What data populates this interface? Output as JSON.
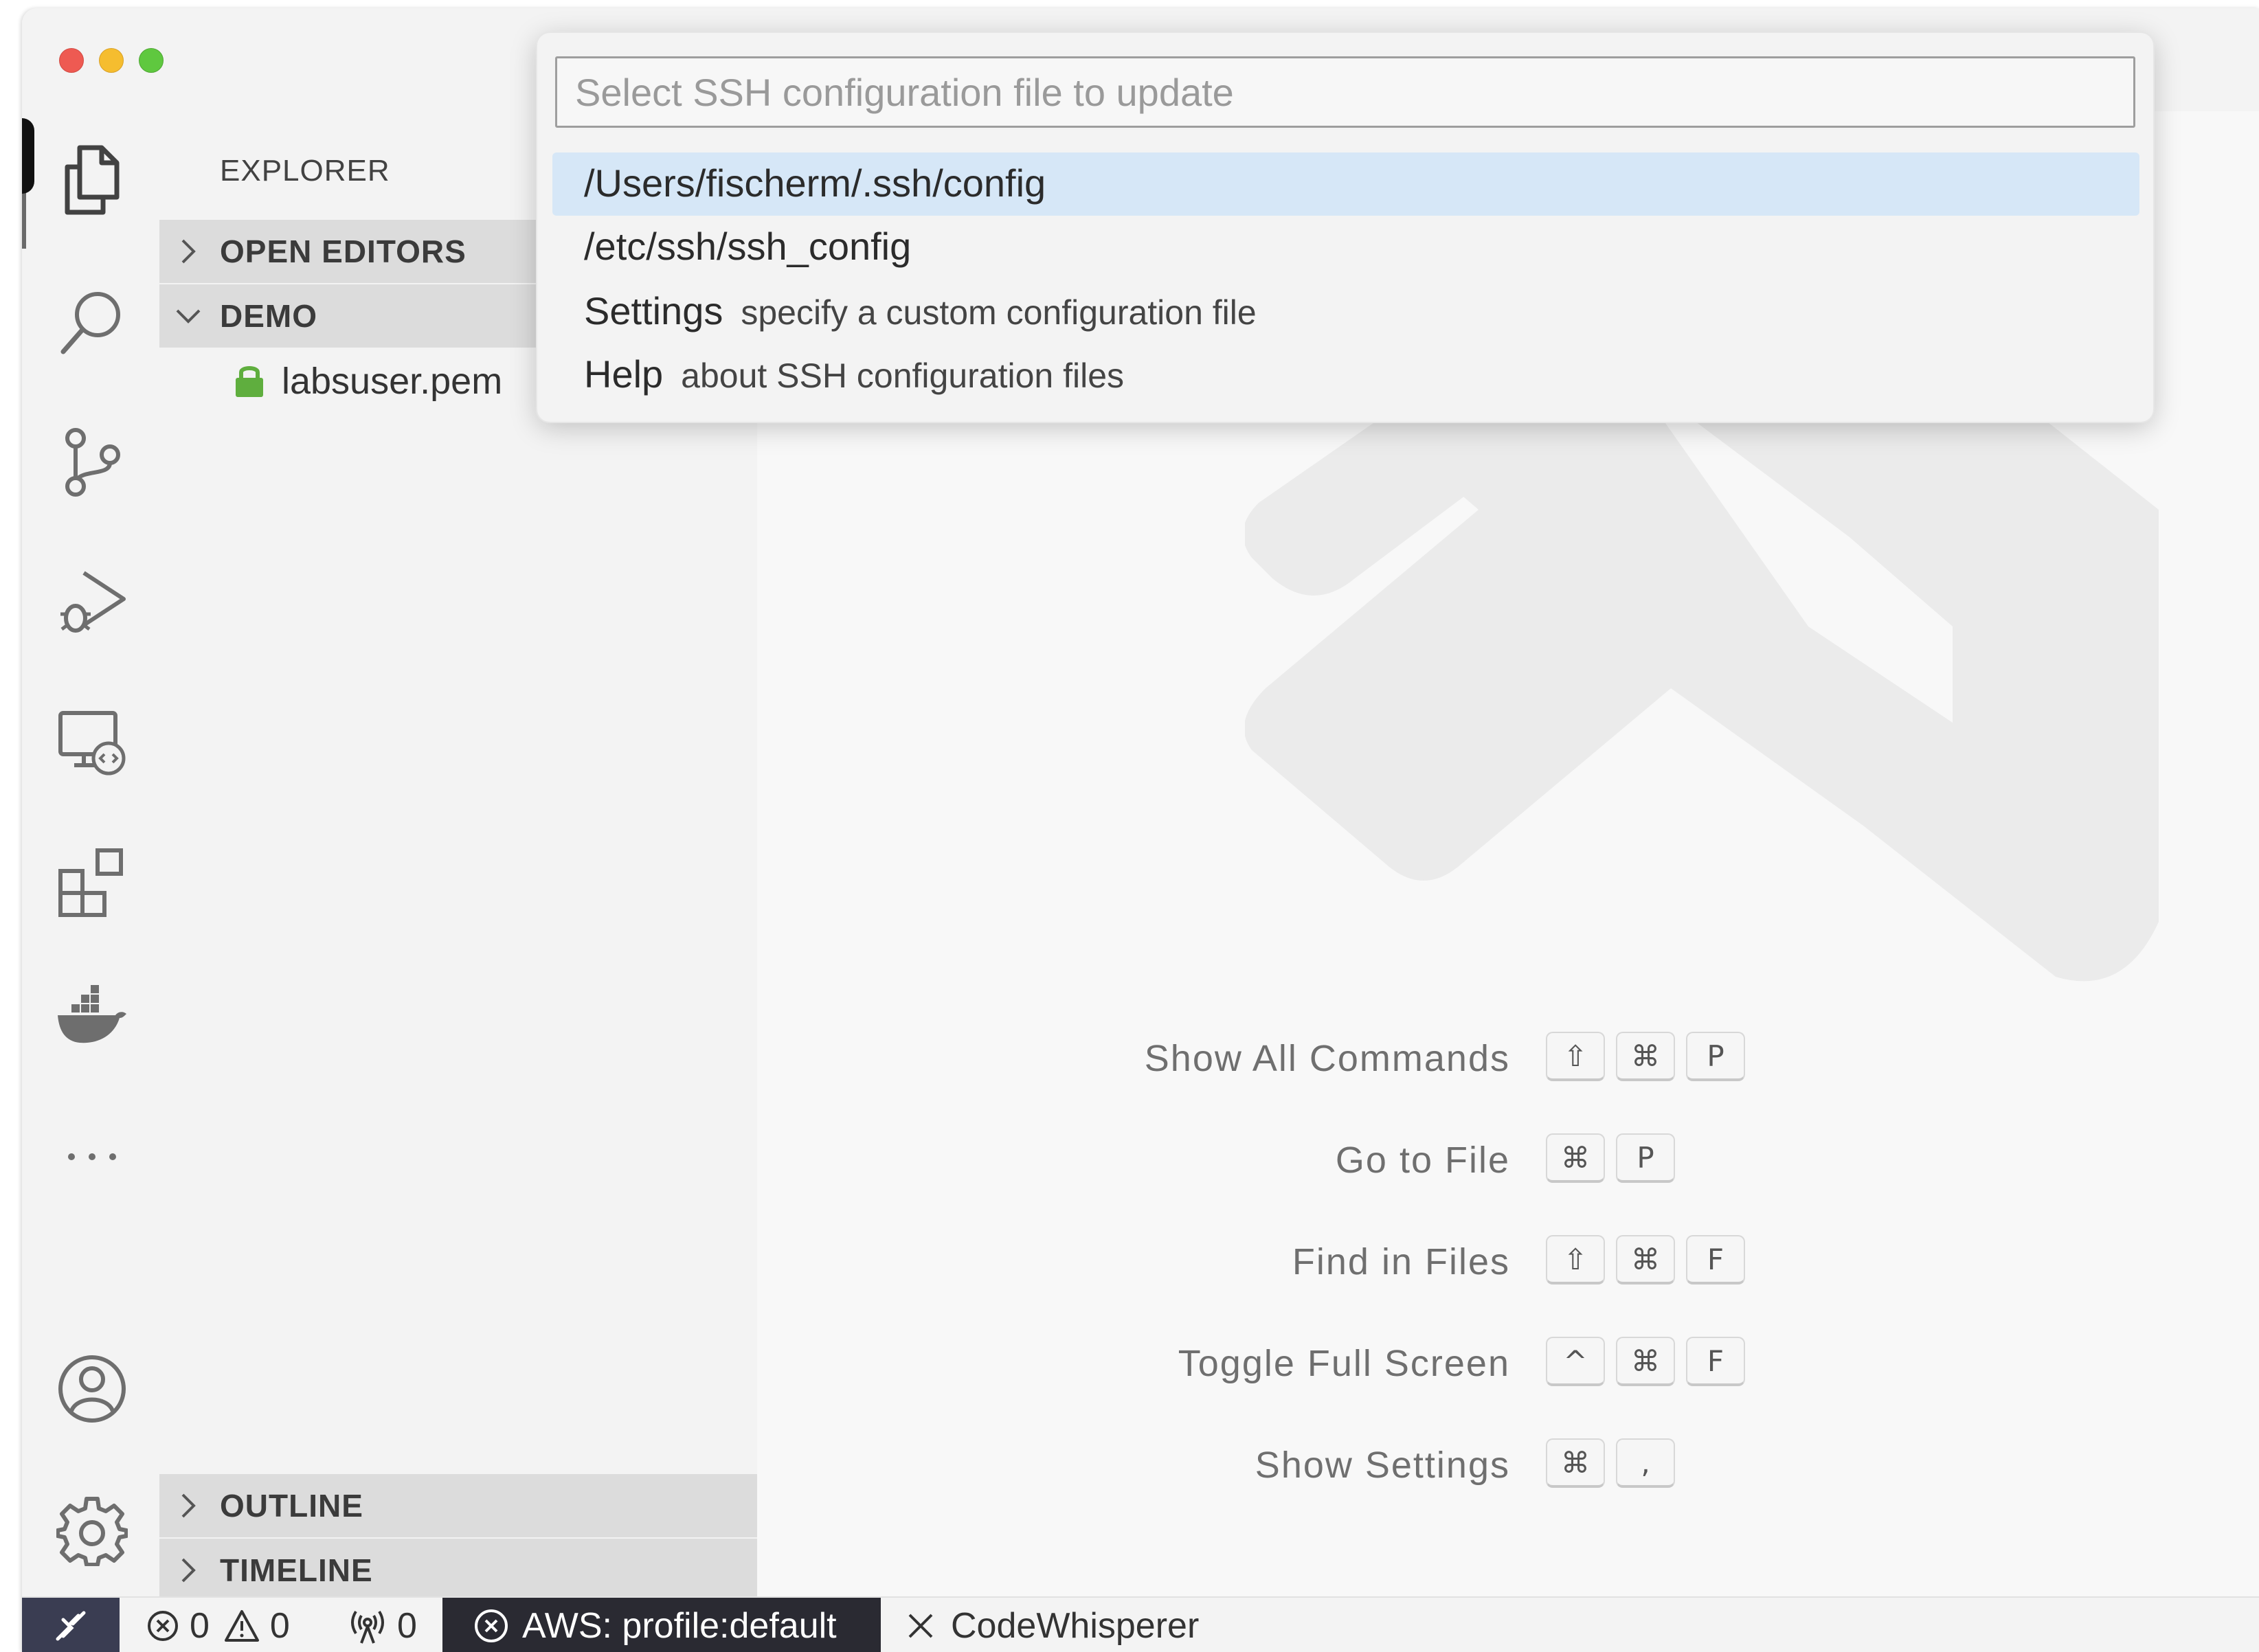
{
  "explorer": {
    "title": "EXPLORER",
    "sections": {
      "open_editors": "OPEN EDITORS",
      "folder": "DEMO",
      "outline": "OUTLINE",
      "timeline": "TIMELINE"
    },
    "files": [
      {
        "name": "labsuser.pem",
        "icon": "lock-icon"
      }
    ]
  },
  "activity_bar": {
    "icons": [
      "files-icon",
      "search-icon",
      "source-control-icon",
      "run-debug-icon",
      "remote-explorer-icon",
      "extensions-icon",
      "docker-icon",
      "more-icon",
      "account-icon",
      "gear-icon"
    ]
  },
  "quick_pick": {
    "placeholder": "Select SSH configuration file to update",
    "items": [
      {
        "label": "/Users/fischerm/.ssh/config",
        "description": ""
      },
      {
        "label": "/etc/ssh/ssh_config",
        "description": ""
      },
      {
        "label": "Settings",
        "description": "specify a custom configuration file"
      },
      {
        "label": "Help",
        "description": "about SSH configuration files"
      }
    ]
  },
  "shortcuts": [
    {
      "label": "Show All Commands",
      "keys": [
        "⇧",
        "⌘",
        "P"
      ]
    },
    {
      "label": "Go to File",
      "keys": [
        "⌘",
        "P"
      ]
    },
    {
      "label": "Find in Files",
      "keys": [
        "⇧",
        "⌘",
        "F"
      ]
    },
    {
      "label": "Toggle Full Screen",
      "keys": [
        "^",
        "⌘",
        "F"
      ]
    },
    {
      "label": "Show Settings",
      "keys": [
        "⌘",
        ","
      ]
    }
  ],
  "status_bar": {
    "errors": "0",
    "warnings": "0",
    "ports": "0",
    "aws": "AWS: profile:default",
    "codewhisperer": "CodeWhisperer"
  },
  "colors": {
    "accent_selection": "#d6e7f7",
    "remote_button": "#3a3d52",
    "aws_item": "#2a2a32",
    "lock": "#5fae3e"
  }
}
